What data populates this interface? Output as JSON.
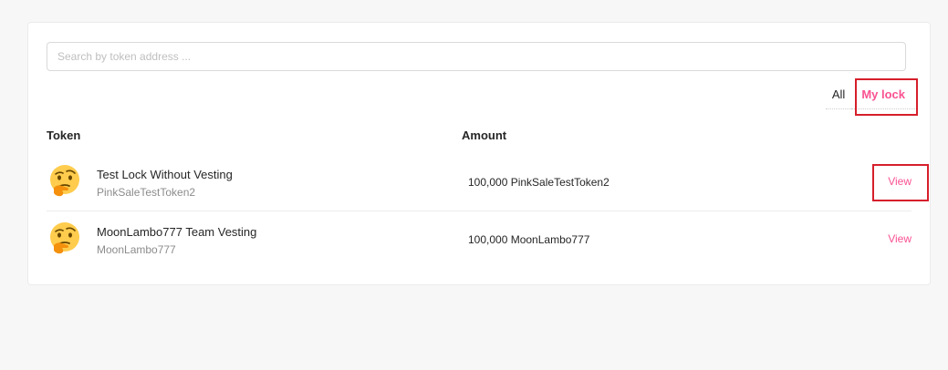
{
  "search": {
    "placeholder": "Search by token address ...",
    "value": ""
  },
  "tabs": [
    {
      "label": "All",
      "active": false
    },
    {
      "label": "My lock",
      "active": true
    }
  ],
  "table": {
    "headers": {
      "token": "Token",
      "amount": "Amount"
    },
    "rows": [
      {
        "icon": "thinking-face-icon",
        "name": "Test Lock Without Vesting",
        "symbol": "PinkSaleTestToken2",
        "amount": "100,000 PinkSaleTestToken2",
        "action": "View"
      },
      {
        "icon": "thinking-face-icon",
        "name": "MoonLambo777 Team Vesting",
        "symbol": "MoonLambo777",
        "amount": "100,000 MoonLambo777",
        "action": "View"
      }
    ]
  },
  "colors": {
    "accent": "#f95192",
    "highlight": "#d61f2b",
    "background": "#f7f7f7"
  }
}
